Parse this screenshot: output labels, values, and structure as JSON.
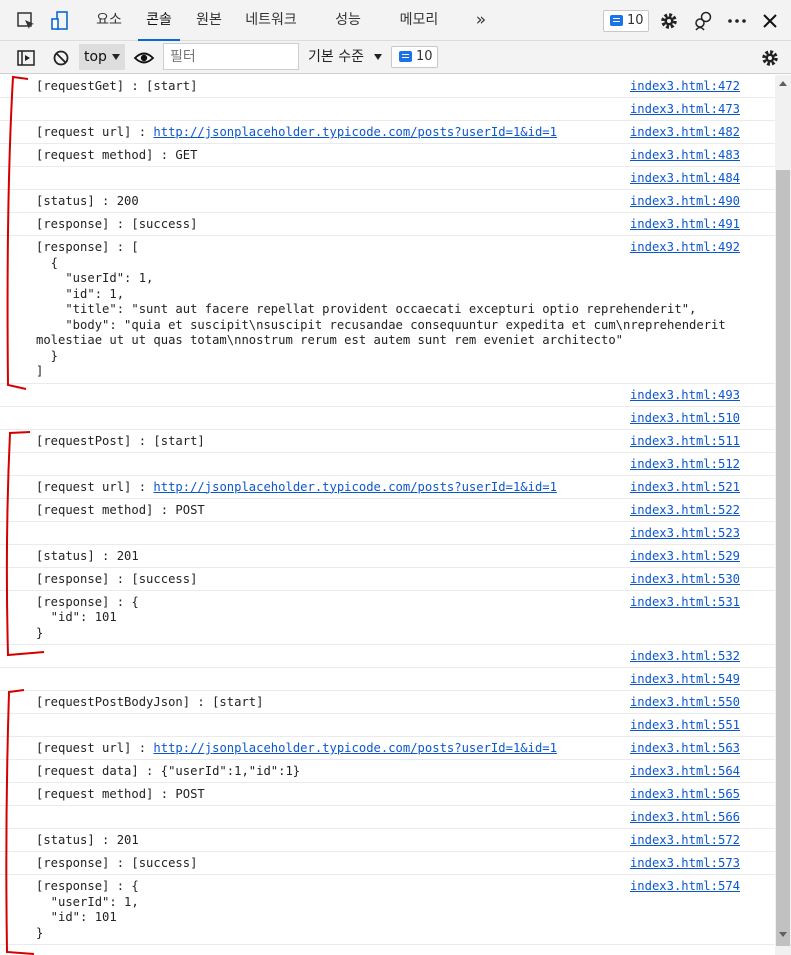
{
  "tabs": [
    "요소",
    "콘솔",
    "원본",
    "네트워크",
    "성능",
    "메모리"
  ],
  "more_tabs_glyph": "»",
  "issue_badge_count": "10",
  "toolbar": {
    "context": "top",
    "filter_placeholder": "필터",
    "levels_label": "기본 수준",
    "message_count": "10"
  },
  "colors": {
    "accent": "#0a68d4",
    "link": "#0b57d0",
    "annotation": "#d40000"
  },
  "console_rows": [
    {
      "text": "[requestGet] : [start]",
      "src": "index3.html:472"
    },
    {
      "text": "",
      "src": "index3.html:473"
    },
    {
      "text": "[request url] : ",
      "url": "http://jsonplaceholder.typicode.com/posts?userId=1&id=1",
      "src": "index3.html:482"
    },
    {
      "text": "[request method] : GET",
      "src": "index3.html:483"
    },
    {
      "text": "",
      "src": "index3.html:484"
    },
    {
      "text": "[status] : 200",
      "src": "index3.html:490"
    },
    {
      "text": "[response] : [success]",
      "src": "index3.html:491"
    },
    {
      "text": "[response] : [\n  {\n    \"userId\": 1,\n    \"id\": 1,\n    \"title\": \"sunt aut facere repellat provident occaecati excepturi optio reprehenderit\",\n    \"body\": \"quia et suscipit\\nsuscipit recusandae consequuntur expedita et cum\\nreprehenderit\nmolestiae ut ut quas totam\\nnostrum rerum est autem sunt rem eveniet architecto\"\n  }\n]",
      "src": "index3.html:492"
    },
    {
      "text": "",
      "src": "index3.html:493"
    },
    {
      "text": "",
      "src": "index3.html:510"
    },
    {
      "text": "[requestPost] : [start]",
      "src": "index3.html:511"
    },
    {
      "text": "",
      "src": "index3.html:512"
    },
    {
      "text": "[request url] : ",
      "url": "http://jsonplaceholder.typicode.com/posts?userId=1&id=1",
      "src": "index3.html:521"
    },
    {
      "text": "[request method] : POST",
      "src": "index3.html:522"
    },
    {
      "text": "",
      "src": "index3.html:523"
    },
    {
      "text": "[status] : 201",
      "src": "index3.html:529"
    },
    {
      "text": "[response] : [success]",
      "src": "index3.html:530"
    },
    {
      "text": "[response] : {\n  \"id\": 101\n}",
      "src": "index3.html:531"
    },
    {
      "text": "",
      "src": "index3.html:532"
    },
    {
      "text": "",
      "src": "index3.html:549"
    },
    {
      "text": "[requestPostBodyJson] : [start]",
      "src": "index3.html:550"
    },
    {
      "text": "",
      "src": "index3.html:551"
    },
    {
      "text": "[request url] : ",
      "url": "http://jsonplaceholder.typicode.com/posts?userId=1&id=1",
      "src": "index3.html:563"
    },
    {
      "text": "[request data] : {\"userId\":1,\"id\":1}",
      "src": "index3.html:564"
    },
    {
      "text": "[request method] : POST",
      "src": "index3.html:565"
    },
    {
      "text": "",
      "src": "index3.html:566"
    },
    {
      "text": "[status] : 201",
      "src": "index3.html:572"
    },
    {
      "text": "[response] : [success]",
      "src": "index3.html:573"
    },
    {
      "text": "[response] : {\n  \"userId\": 1,\n  \"id\": 101\n}",
      "src": "index3.html:574"
    }
  ]
}
